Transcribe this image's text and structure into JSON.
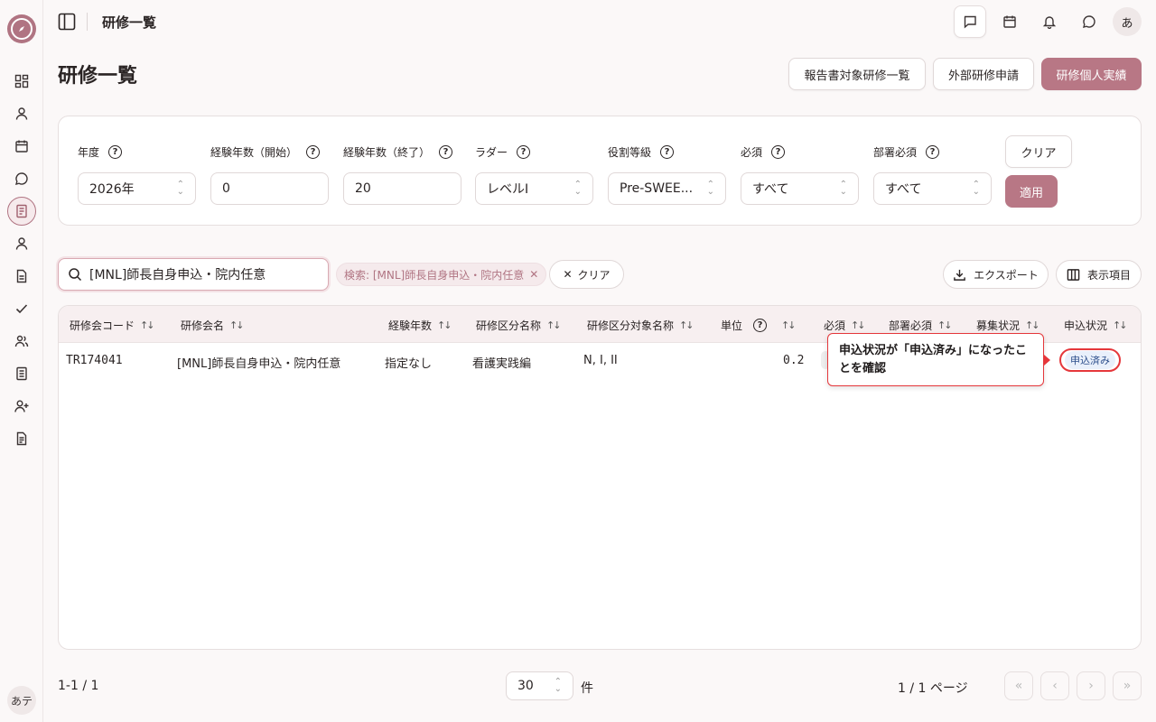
{
  "sidebar": {
    "items": [
      {
        "icon": "dashboard-icon"
      },
      {
        "icon": "user-icon"
      },
      {
        "icon": "calendar-icon"
      },
      {
        "icon": "chat-icon"
      },
      {
        "icon": "document-icon",
        "active": true
      },
      {
        "icon": "user-icon"
      },
      {
        "icon": "file-icon"
      },
      {
        "icon": "check-icon"
      },
      {
        "icon": "users-icon"
      },
      {
        "icon": "book-icon"
      },
      {
        "icon": "user-plus-icon"
      },
      {
        "icon": "file-text-icon"
      }
    ],
    "user_initials": "あテ"
  },
  "header": {
    "breadcrumb": "研修一覧",
    "avatar": "あ"
  },
  "page": {
    "title": "研修一覧",
    "actions": {
      "report_list": "報告書対象研修一覧",
      "external_apply": "外部研修申請",
      "personal_record": "研修個人実績"
    }
  },
  "filters": {
    "fields": [
      {
        "label": "年度",
        "value": "2026年",
        "type": "select"
      },
      {
        "label": "経験年数（開始）",
        "value": "0",
        "type": "input"
      },
      {
        "label": "経験年数（終了）",
        "value": "20",
        "type": "input"
      },
      {
        "label": "ラダー",
        "value": "レベルI",
        "type": "select"
      },
      {
        "label": "役割等級",
        "value": "Pre-SWEE...",
        "type": "select"
      },
      {
        "label": "必須",
        "value": "すべて",
        "type": "select"
      },
      {
        "label": "部署必須",
        "value": "すべて",
        "type": "select"
      }
    ],
    "clear_label": "クリア",
    "apply_label": "適用"
  },
  "search": {
    "value": "[MNL]師長自身申込・院内任意",
    "chip": "検索: [MNL]師長自身申込・院内任意",
    "clear_label": "クリア",
    "export_label": "エクスポート",
    "columns_label": "表示項目"
  },
  "table": {
    "headers": [
      "研修会コード",
      "研修会名",
      "経験年数",
      "研修区分名称",
      "研修区分対象名称",
      "単位",
      "必須",
      "部署必須",
      "募集状況",
      "申込状況"
    ],
    "rows": [
      {
        "code": "TR174041",
        "name": "[MNL]師長自身申込・院内任意",
        "experience": "指定なし",
        "category": "看護実践編",
        "target": "N, I, II",
        "unit": "0.2",
        "status": "申込済み"
      }
    ]
  },
  "tooltip": {
    "text": "申込状況が「申込済み」になったことを確認"
  },
  "footer": {
    "count": "1-1 / 1",
    "per_page": "30",
    "unit": "件",
    "page_info": "1 / 1 ページ"
  },
  "colors": {
    "accent": "#b87785",
    "highlight": "#e5373b"
  }
}
